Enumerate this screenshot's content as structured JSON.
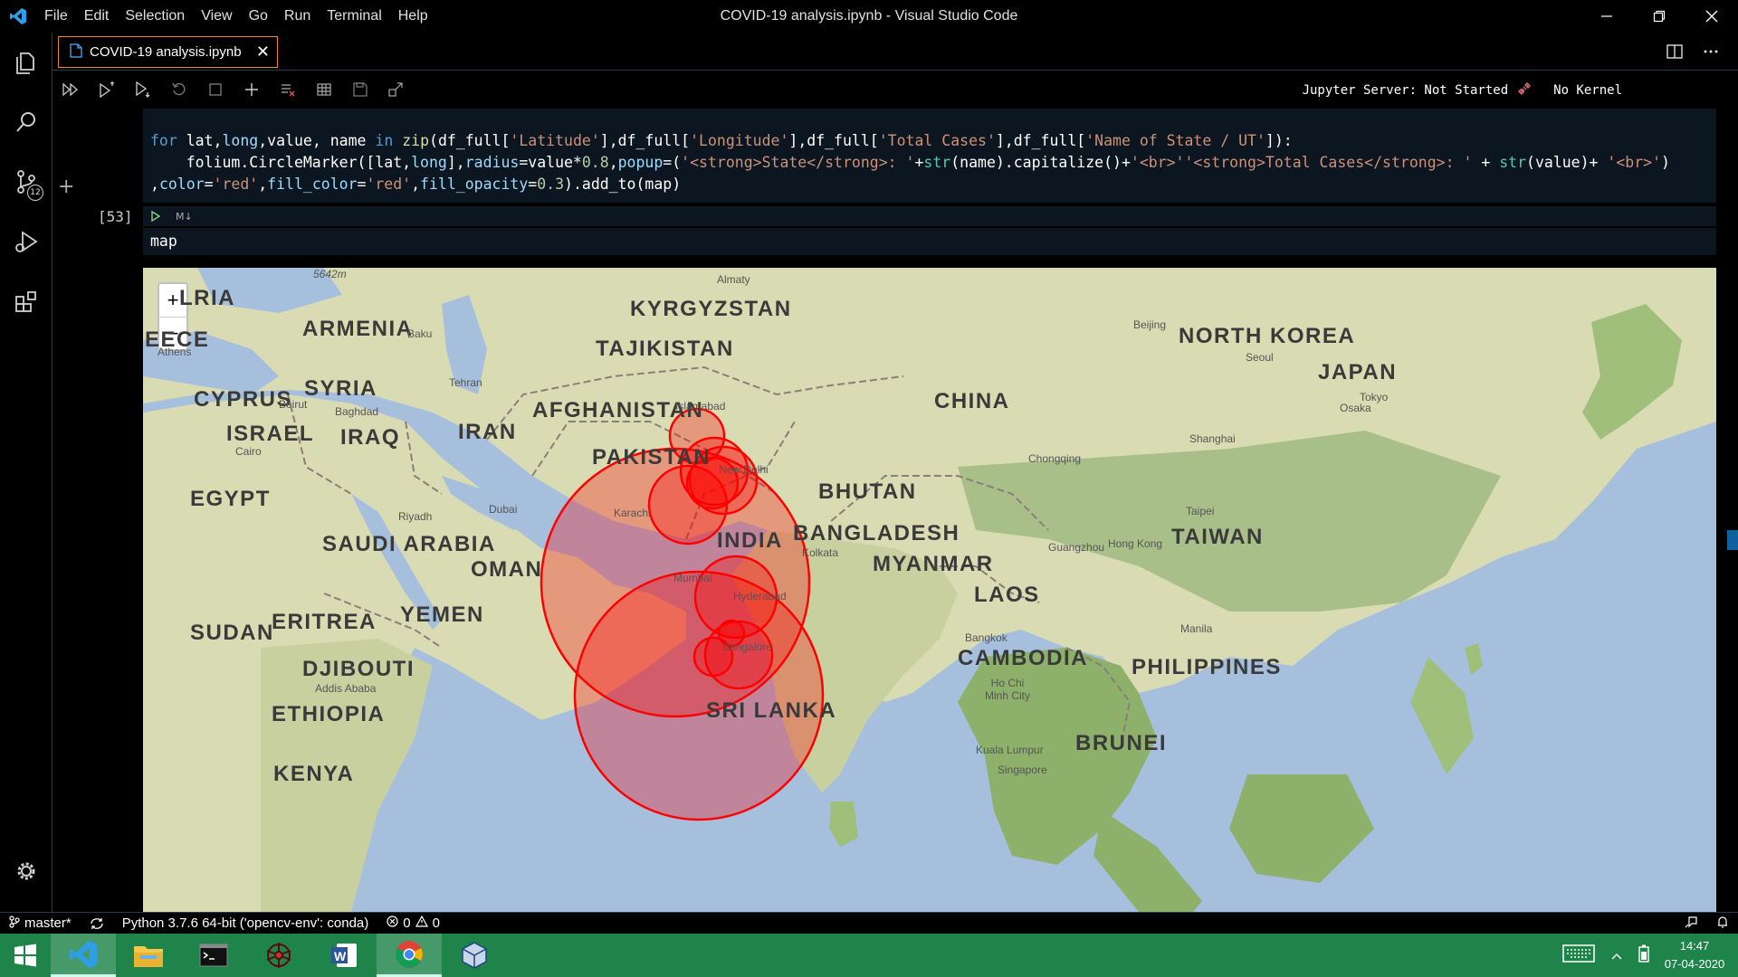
{
  "titlebar": {
    "menu": [
      "File",
      "Edit",
      "Selection",
      "View",
      "Go",
      "Run",
      "Terminal",
      "Help"
    ],
    "window_title": "COVID-19 analysis.ipynb - Visual Studio Code"
  },
  "activitybar": {
    "scm_badge": "12"
  },
  "tab": {
    "label": "COVID-19 analysis.ipynb",
    "close": "✕"
  },
  "notebook_toolbar": {
    "server_status": "Jupyter Server: Not Started",
    "kernel": "No Kernel"
  },
  "cells": {
    "cell1_lines": [
      "for lat,long,value, name in zip(df_full['Latitude'],df_full['Longitude'],df_full['Total Cases'],df_full['Name of State / UT']):",
      "    folium.CircleMarker([lat,long],radius=value*0.8,popup=('<strong>State</strong>: '+str(name).capitalize()+'<br>''<strong>Total Cases</strong>: ' + str(value)+ '<br>')",
      ",color='red',fill_color='red',fill_opacity=0.3).add_to(map)"
    ],
    "exec_count": "[53]",
    "cell2_type": "M↓",
    "cell2_code": "map"
  },
  "map": {
    "zoom_in": "+",
    "zoom_out": "−",
    "countries": [
      "LRIA",
      "ARMENIA",
      "EECE",
      "CYPRUS",
      "SYRIA",
      "ISRAEL",
      "IRAQ",
      "IRAN",
      "AFGHANISTAN",
      "PAKISTAN",
      "TAJIKISTAN",
      "KYRGYZSTAN",
      "CHINA",
      "NORTH KOREA",
      "JAPAN",
      "EGYPT",
      "SAUDI ARABIA",
      "OMAN",
      "YEMEN",
      "SUDAN",
      "ERITREA",
      "DJIBOUTI",
      "ETHIOPIA",
      "KENYA",
      "INDIA",
      "BHUTAN",
      "BANGLADESH",
      "MYANMAR",
      "LAOS",
      "CAMBODIA",
      "SRI LANKA",
      "TAIWAN",
      "PHILIPPINES",
      "BRUNEI"
    ],
    "cities": [
      "5642m",
      "Almaty",
      "Baku",
      "Athens",
      "Tehran",
      "Beirut",
      "Baghdad",
      "Cairo",
      "Islamabad",
      "Beijing",
      "Seoul",
      "Tokyo",
      "Osaka",
      "Shanghai",
      "Chongqing",
      "New Delhi",
      "Karachi",
      "Dubai",
      "Riyadh",
      "Mumbai",
      "Hyderabad",
      "Kolkata",
      "Taipei",
      "Guangzhou",
      "Hong Kong",
      "Bangalore",
      "Bangkok",
      "Manila",
      "Ho Chi Minh City",
      "Addis Ababa",
      "Kuala Lumpur",
      "Singapore"
    ],
    "marker_color": "#ff0000"
  },
  "statusbar": {
    "branch": "master*",
    "interpreter": "Python 3.7.6 64-bit ('opencv-env': conda)",
    "errors": "0",
    "warnings": "0"
  },
  "taskbar": {
    "time": "14:47",
    "date": "07-04-2020"
  },
  "colors": {
    "accent": "#0e639c",
    "taskbar": "#1e8449",
    "tab_border": "#f38518",
    "marker": "#ff0000"
  }
}
